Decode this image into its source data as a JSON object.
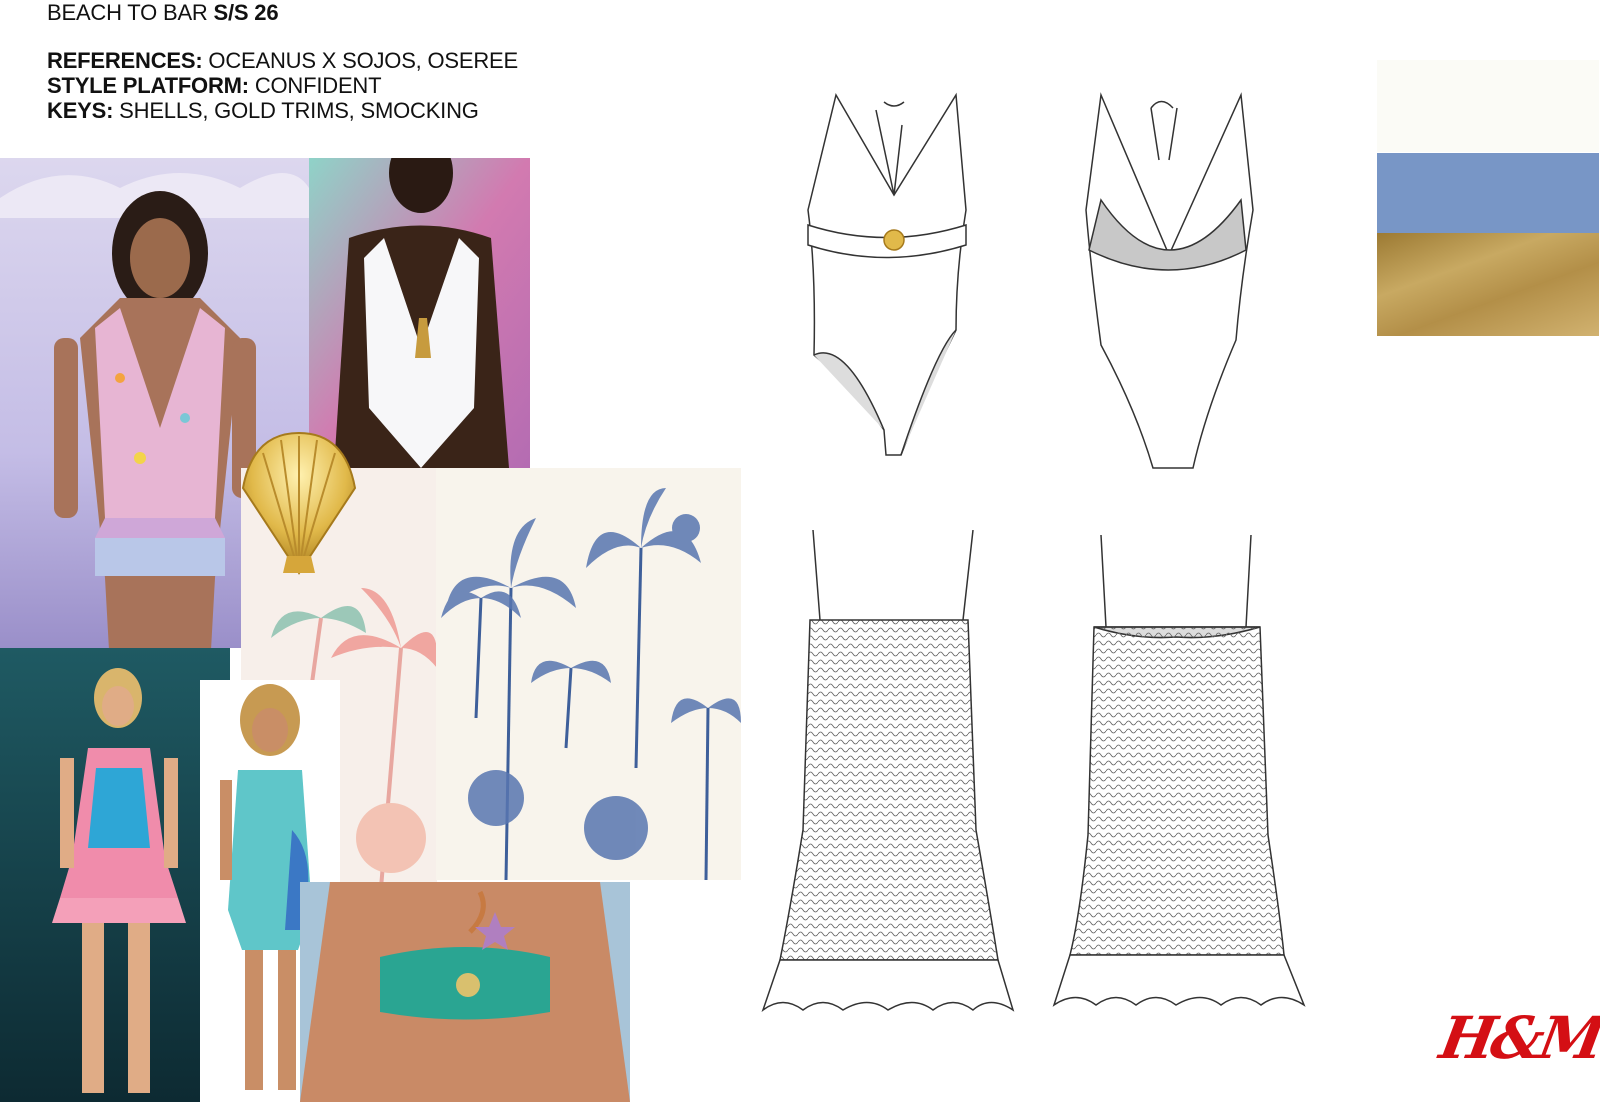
{
  "header": {
    "title_prefix": "BEACH TO BAR ",
    "title_season": "S/S 26",
    "references_label": "REFERENCES:",
    "references_value": " OCEANUS X SOJOS, OSEREE",
    "platform_label": "STYLE PLATFORM:",
    "platform_value": " CONFIDENT",
    "keys_label": "KEYS:",
    "keys_value": " SHELLS, GOLD TRIMS, SMOCKING"
  },
  "moodboard": {
    "images": [
      {
        "name": "runway-embellished-plunge-dress",
        "icon": "photo-icon"
      },
      {
        "name": "runway-white-halter-swimsuit",
        "icon": "photo-icon"
      },
      {
        "name": "gold-shell-ornament",
        "icon": "shell-icon"
      },
      {
        "name": "pink-palm-print",
        "icon": "palm-icon"
      },
      {
        "name": "blue-toile-palm-print",
        "icon": "palm-icon"
      },
      {
        "name": "runway-printed-mini-dress",
        "icon": "photo-icon"
      },
      {
        "name": "runway-aqua-sequin-dress",
        "icon": "photo-icon"
      },
      {
        "name": "green-bandeau-bikini-top",
        "icon": "photo-icon"
      }
    ]
  },
  "flats": [
    {
      "name": "swimsuit-front-flat",
      "view": "front"
    },
    {
      "name": "swimsuit-back-flat",
      "view": "back"
    },
    {
      "name": "smocked-dress-front-flat",
      "view": "front"
    },
    {
      "name": "smocked-dress-back-flat",
      "view": "back"
    }
  ],
  "palette": {
    "colors": [
      "#fbfbf6",
      "#7896c6",
      "#b8964e"
    ]
  },
  "brand": {
    "logo_text": "H&M",
    "logo_color": "#d40f14"
  }
}
